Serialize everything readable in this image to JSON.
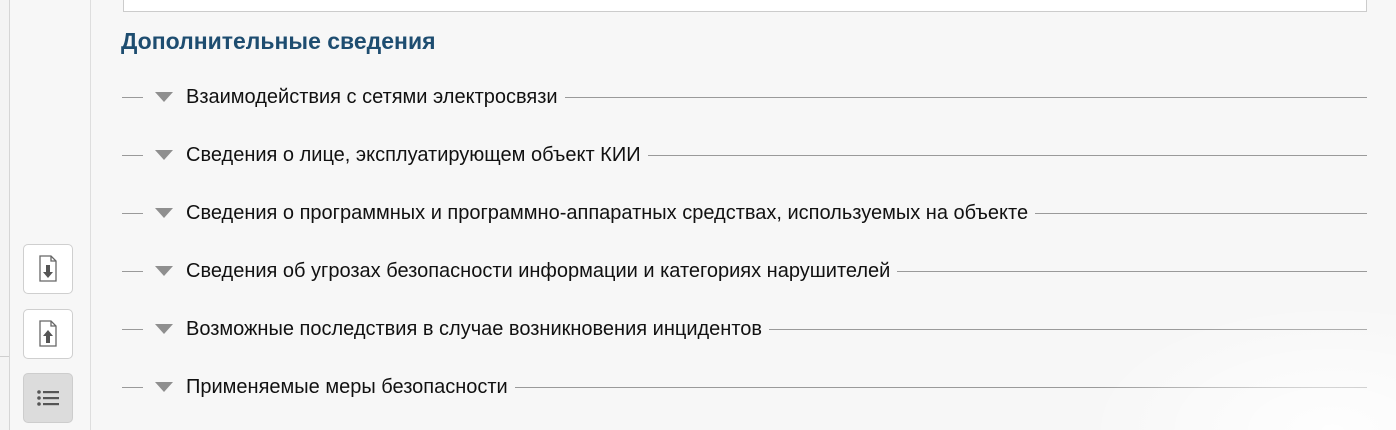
{
  "section": {
    "title": "Дополнительные сведения"
  },
  "sections_list": [
    {
      "label": "Взаимодействия с сетями электросвязи",
      "icon": "triangle-down-icon"
    },
    {
      "label": "Сведения о лице, эксплуатирующем объект КИИ",
      "icon": "triangle-down-icon"
    },
    {
      "label": "Сведения о программных и программно-аппаратных средствах, используемых на объекте",
      "icon": "triangle-down-icon"
    },
    {
      "label": "Сведения об угрозах безопасности информации и категориях нарушителей",
      "icon": "triangle-down-icon"
    },
    {
      "label": "Возможные последствия в случае возникновения инцидентов",
      "icon": "triangle-down-icon"
    },
    {
      "label": "Применяемые меры безопасности",
      "icon": "triangle-down-icon"
    }
  ],
  "toolbar": {
    "buttons": [
      {
        "icon": "file-download-icon"
      },
      {
        "icon": "file-upload-icon"
      },
      {
        "icon": "list-icon",
        "active": true
      }
    ]
  },
  "colors": {
    "title": "#1e4d70",
    "text": "#111111",
    "rule": "#9a9a9a",
    "caret": "#8f8f8f",
    "background": "#f7f7f7"
  }
}
